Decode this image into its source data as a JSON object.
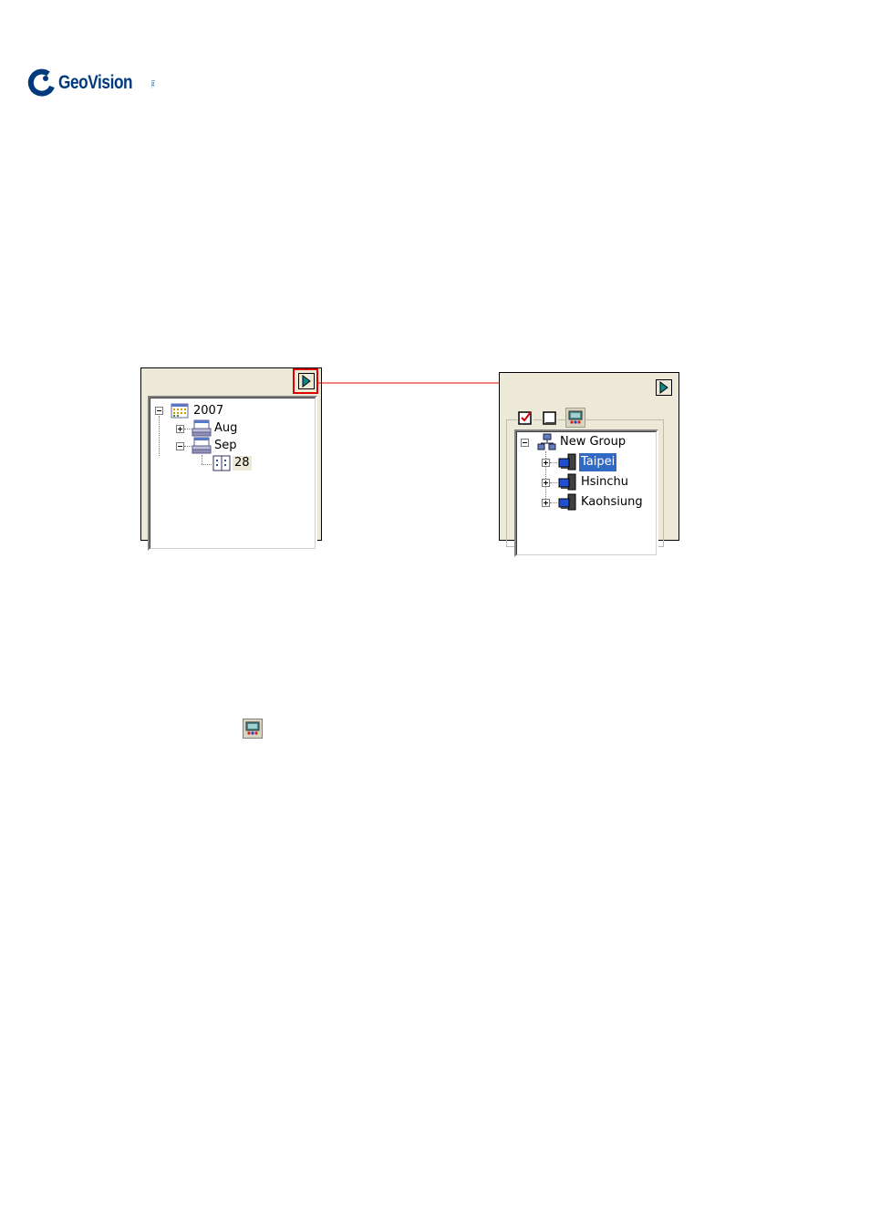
{
  "brand": {
    "name": "GeoVision",
    "tm": "Inc."
  },
  "left_panel": {
    "tree": {
      "year": "2007",
      "months": [
        "Aug",
        "Sep"
      ],
      "day": "28"
    }
  },
  "right_panel": {
    "tree": {
      "root": "New Group",
      "hosts": [
        "Taipei",
        "Hsinchu",
        "Kaohsiung"
      ],
      "selected": "Taipei"
    }
  },
  "colors": {
    "highlight_red": "#e00000",
    "selection_blue": "#316ac5",
    "panel_bg": "#ece9d8",
    "brand_blue": "#003a7d"
  },
  "icons": {
    "expand_button": "play-arrow-icon",
    "inline_icon": "group-view-icon"
  }
}
